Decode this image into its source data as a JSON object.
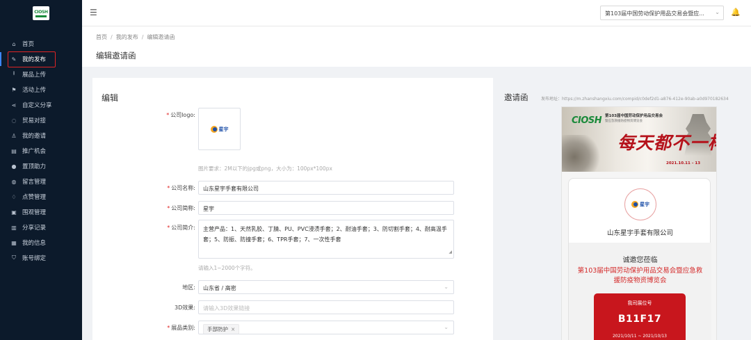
{
  "app": {
    "logo_text": "CIOSH"
  },
  "sidebar": {
    "items": [
      {
        "label": "首页",
        "icon": "home-icon",
        "glyph": "⌂"
      },
      {
        "label": "我的发布",
        "icon": "edit-icon",
        "glyph": "✎"
      },
      {
        "label": "展品上传",
        "icon": "upload-icon",
        "glyph": "⭱"
      },
      {
        "label": "活动上传",
        "icon": "flag-icon",
        "glyph": "⚑"
      },
      {
        "label": "自定义分享",
        "icon": "share-icon",
        "glyph": "⋖"
      },
      {
        "label": "贸易对接",
        "icon": "chat-icon",
        "glyph": "◌"
      },
      {
        "label": "我的邀请",
        "icon": "users-icon",
        "glyph": "♙"
      },
      {
        "label": "推广机会",
        "icon": "promo-icon",
        "glyph": "▤"
      },
      {
        "label": "置顶助力",
        "icon": "top-icon",
        "glyph": "●"
      },
      {
        "label": "留言管理",
        "icon": "message-icon",
        "glyph": "◍"
      },
      {
        "label": "点赞管理",
        "icon": "like-icon",
        "glyph": "♢"
      },
      {
        "label": "围观管理",
        "icon": "watch-icon",
        "glyph": "▣"
      },
      {
        "label": "分享记录",
        "icon": "record-icon",
        "glyph": "▥"
      },
      {
        "label": "我的信息",
        "icon": "info-icon",
        "glyph": "▦"
      },
      {
        "label": "账号绑定",
        "icon": "shield-icon",
        "glyph": "⛉"
      }
    ],
    "active_index": 1
  },
  "header": {
    "menu_icon": "☰",
    "expo_select": "第103届中国劳动保护用品交易会暨应...",
    "chevron": "⌄",
    "bell": "🔔"
  },
  "breadcrumb": {
    "items": [
      "首页",
      "我的发布",
      "编辑邀请函"
    ],
    "sep": "/"
  },
  "page_title": "编辑邀请函",
  "editor": {
    "title": "编辑",
    "logo_label": "公司logo:",
    "logo_mark_text": "星宇",
    "logo_hint": "图片要求：2M以下的jpg或png，大小为：100px*100px",
    "name_label": "公司名称:",
    "name_value": "山东星宇手套有限公司",
    "short_label": "公司简称:",
    "short_value": "星宇",
    "intro_label": "公司简介:",
    "intro_value": "主营产品：1、天然乳胶、丁腈、PU、PVC浸渍手套；2、耐油手套；3、防切割手套；4、耐高温手套；5、防振、防撞手套；6、TPR手套；7、一次性手套",
    "intro_hint": "请输入1~2000个字符。",
    "region_label": "地区:",
    "region_value": "山东省 / 高密",
    "model3d_label": "3D效果:",
    "model3d_placeholder": "请输入3D效果链接",
    "category_label": "展品类别:",
    "category_tag": "手部防护",
    "required_mark": "*"
  },
  "preview": {
    "title": "邀请函",
    "url": "发布地址：https://m.zhanshangxiu.com/compid/c0def2d1-a876-412e-90ab-a0d970182634",
    "banner": {
      "logo": "CIOSH",
      "headline": "第103届中国劳动保护用品交易会",
      "subline": "暨应急救援防疫物资博览会",
      "slogan": "每天都不一样",
      "date": "2021.10.11 – 13"
    },
    "company_name": "山东星宇手套有限公司",
    "welcome": "诚邀您莅临",
    "expo_name": "第103届中国劳动保护用品交易会暨应急救援防疫物资博览会",
    "booth_label": "我司展位号",
    "booth_no": "B11F17",
    "booth_dates": "2021/10/11 ~ 2021/10/13"
  }
}
